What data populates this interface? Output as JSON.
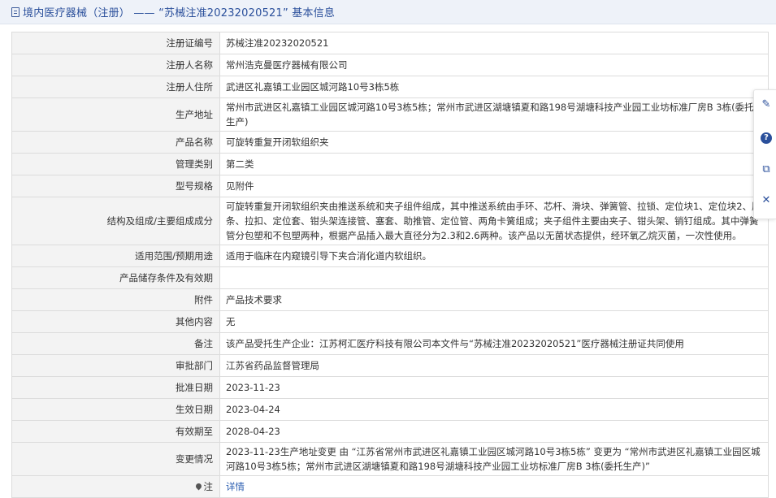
{
  "header": {
    "title": "境内医疗器械（注册） —— “苏械注准20232020521” 基本信息"
  },
  "rows": [
    {
      "label": "注册证编号",
      "value": "苏械注准20232020521"
    },
    {
      "label": "注册人名称",
      "value": "常州浩克曼医疗器械有限公司"
    },
    {
      "label": "注册人住所",
      "value": "武进区礼嘉镇工业园区城河路10号3栋5栋"
    },
    {
      "label": "生产地址",
      "value": "常州市武进区礼嘉镇工业园区城河路10号3栋5栋；常州市武进区湖塘镇夏和路198号湖塘科技产业园工业坊标准厂房B 3栋(委托生产)"
    },
    {
      "label": "产品名称",
      "value": "可旋转重复开闭软组织夹"
    },
    {
      "label": "管理类别",
      "value": "第二类"
    },
    {
      "label": "型号规格",
      "value": "见附件"
    },
    {
      "label": "结构及组成/主要组成成分",
      "value": "可旋转重复开闭软组织夹由推送系统和夹子组件组成，其中推送系统由手环、芯杆、滑块、弹簧管、拉锁、定位块1、定位块2、压条、拉扣、定位套、钳头架连接管、塞套、助推管、定位管、两角卡簧组成；夹子组件主要由夹子、钳头架、销钉组成。其中弹簧管分包塑和不包塑两种，根据产品插入最大直径分为2.3和2.6两种。该产品以无菌状态提供，经环氧乙烷灭菌，一次性使用。"
    },
    {
      "label": "适用范围/预期用途",
      "value": "适用于临床在内窥镜引导下夹合消化道内软组织。"
    },
    {
      "label": "产品储存条件及有效期",
      "value": ""
    },
    {
      "label": "附件",
      "value": "产品技术要求"
    },
    {
      "label": "其他内容",
      "value": "无"
    },
    {
      "label": "备注",
      "value": "该产品受托生产企业：江苏柯汇医疗科技有限公司本文件与“苏械注准20232020521”医疗器械注册证共同使用"
    },
    {
      "label": "审批部门",
      "value": "江苏省药品监督管理局"
    },
    {
      "label": "批准日期",
      "value": "2023-11-23"
    },
    {
      "label": "生效日期",
      "value": "2023-04-24"
    },
    {
      "label": "有效期至",
      "value": "2028-04-23"
    },
    {
      "label": "变更情况",
      "value": "2023-11-23生产地址变更 由 “江苏省常州市武进区礼嘉镇工业园区城河路10号3栋5栋” 变更为 “常州市武进区礼嘉镇工业园区城河路10号3栋5栋；常州市武进区湖塘镇夏和路198号湖塘科技产业园工业坊标准厂房B 3栋(委托生产)”"
    }
  ],
  "note": {
    "label": "注",
    "link": "详情"
  },
  "sidetools": {
    "icons": [
      "edit-icon",
      "help-icon",
      "copy-icon",
      "close-icon"
    ]
  }
}
